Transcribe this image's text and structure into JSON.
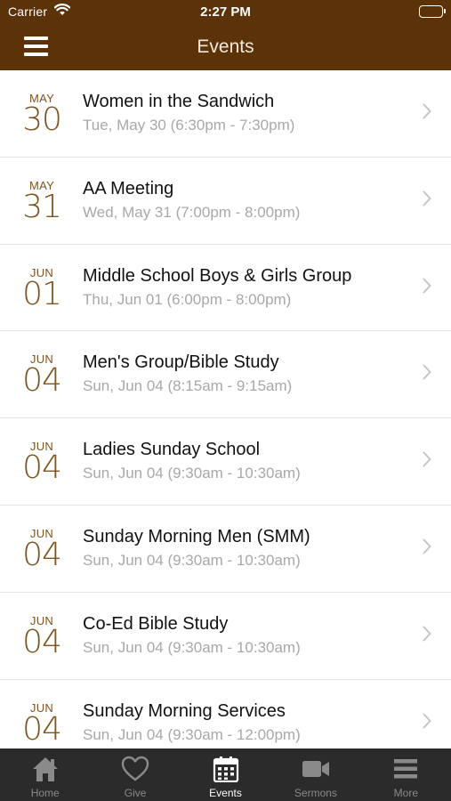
{
  "status_bar": {
    "carrier": "Carrier",
    "time": "2:27 PM"
  },
  "nav": {
    "title": "Events",
    "menu_icon": "hamburger-menu-icon"
  },
  "events": [
    {
      "month": "MAY",
      "day": "30",
      "title": "Women in the Sandwich",
      "subtitle": "Tue, May 30 (6:30pm - 7:30pm)"
    },
    {
      "month": "MAY",
      "day": "31",
      "title": "AA Meeting",
      "subtitle": "Wed, May 31 (7:00pm - 8:00pm)"
    },
    {
      "month": "JUN",
      "day": "01",
      "title": "Middle School Boys & Girls Group",
      "subtitle": "Thu, Jun 01 (6:00pm - 8:00pm)"
    },
    {
      "month": "JUN",
      "day": "04",
      "title": "Men's Group/Bible Study",
      "subtitle": "Sun, Jun 04 (8:15am - 9:15am)"
    },
    {
      "month": "JUN",
      "day": "04",
      "title": "Ladies Sunday School",
      "subtitle": "Sun, Jun 04 (9:30am - 10:30am)"
    },
    {
      "month": "JUN",
      "day": "04",
      "title": "Sunday Morning Men (SMM)",
      "subtitle": "Sun, Jun 04 (9:30am - 10:30am)"
    },
    {
      "month": "JUN",
      "day": "04",
      "title": "Co-Ed Bible Study",
      "subtitle": "Sun, Jun 04 (9:30am - 10:30am)"
    },
    {
      "month": "JUN",
      "day": "04",
      "title": "Sunday Morning Services",
      "subtitle": "Sun, Jun 04 (9:30am - 12:00pm)"
    }
  ],
  "tabs": [
    {
      "label": "Home",
      "icon": "home-icon",
      "active": false
    },
    {
      "label": "Give",
      "icon": "heart-icon",
      "active": false
    },
    {
      "label": "Events",
      "icon": "calendar-icon",
      "active": true
    },
    {
      "label": "Sermons",
      "icon": "video-camera-icon",
      "active": false
    },
    {
      "label": "More",
      "icon": "more-menu-icon",
      "active": false
    }
  ],
  "colors": {
    "header_bg": "#5c3208",
    "date_accent": "#7d5320",
    "tabbar_bg": "#2b2b2b",
    "tab_inactive": "#8a8a8a",
    "tab_active": "#ffffff"
  }
}
